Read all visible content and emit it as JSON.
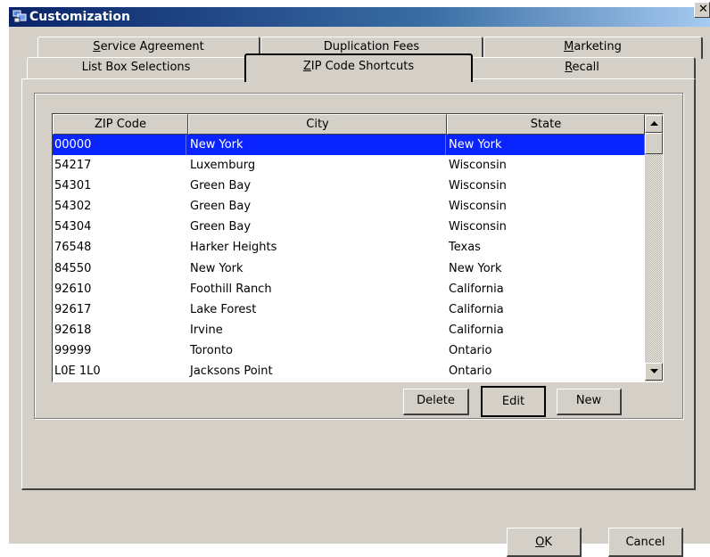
{
  "window": {
    "title": "Customization",
    "close_glyph": "✕"
  },
  "tabs": {
    "back_row": [
      {
        "label": "Service Agreement",
        "mnemonic_first": "S",
        "rest": "ervice Agreement"
      },
      {
        "label": "Duplication Fees",
        "mnemonic_first": "",
        "rest": "Duplication Fees"
      },
      {
        "label": "Marketing",
        "mnemonic_first": "M",
        "rest": "arketing"
      }
    ],
    "front_row": [
      {
        "label": "List Box Selections",
        "mnemonic_first": "",
        "rest": "List Box Selections"
      },
      {
        "label": "ZIP Code Shortcuts",
        "mnemonic_first": "Z",
        "rest": "IP Code Shortcuts",
        "selected": true
      },
      {
        "label": "Recall",
        "mnemonic_first": "R",
        "rest": "ecall"
      }
    ]
  },
  "table": {
    "columns": [
      "ZIP Code",
      "City",
      "State"
    ],
    "rows": [
      [
        "00000",
        "New York",
        "New York"
      ],
      [
        "54217",
        "Luxemburg",
        "Wisconsin"
      ],
      [
        "54301",
        "Green Bay",
        "Wisconsin"
      ],
      [
        "54302",
        "Green Bay",
        "Wisconsin"
      ],
      [
        "54304",
        "Green Bay",
        "Wisconsin"
      ],
      [
        "76548",
        "Harker Heights",
        "Texas"
      ],
      [
        "84550",
        "New York",
        "New York"
      ],
      [
        "92610",
        "Foothill Ranch",
        "California"
      ],
      [
        "92617",
        "Lake Forest",
        "California"
      ],
      [
        "92618",
        "Irvine",
        "California"
      ],
      [
        "99999",
        "Toronto",
        "Ontario"
      ],
      [
        "L0E 1L0",
        "Jacksons Point",
        "Ontario"
      ]
    ],
    "selected_row": 0
  },
  "list_buttons": {
    "delete": "Delete",
    "edit": "Edit",
    "new": "New"
  },
  "dialog_buttons": {
    "ok_mnemonic": "O",
    "ok_rest": "K",
    "cancel": "Cancel"
  },
  "colors": {
    "title_bar": "#0a246a",
    "selection": "#0a24ff",
    "face": "#d4d0c8"
  },
  "icons": {
    "app": "customization-app-icon",
    "scroll_up": "arrow-up-icon",
    "scroll_down": "arrow-down-icon"
  }
}
